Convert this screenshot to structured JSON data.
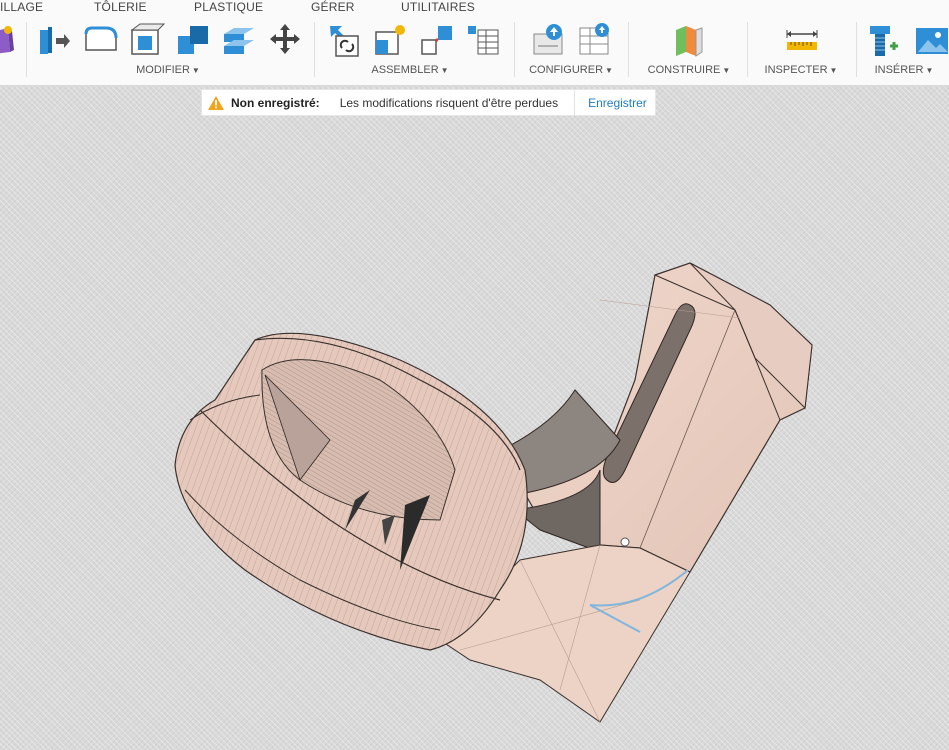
{
  "tabs": [
    "ILLAGE",
    "TÔLERIE",
    "PLASTIQUE",
    "GÉRER",
    "UTILITAIRES"
  ],
  "groups": {
    "modifier": "MODIFIER",
    "assembler": "ASSEMBLER",
    "configurer": "CONFIGURER",
    "construire": "CONSTRUIRE",
    "inspecter": "INSPECTER",
    "inserer": "INSÉRER"
  },
  "banner": {
    "title": "Non enregistré:",
    "message": "Les modifications risquent d'être perdues",
    "action": "Enregistrer"
  },
  "colors": {
    "accent": "#1f7cc4",
    "warning": "#f2a41c",
    "part": "#e9cfc3",
    "tool_blue": "#2e8fd6"
  },
  "icons": [
    "create-box-icon",
    "press-pull-icon",
    "fillet-icon",
    "shell-icon",
    "combine-icon",
    "offset-face-icon",
    "move-icon",
    "joint-icon",
    "new-component-icon",
    "rigid-group-icon",
    "bom-table-icon",
    "config-icon",
    "config-table-icon",
    "plane-icon",
    "measure-icon",
    "insert-bolt-icon",
    "insert-image-icon"
  ]
}
